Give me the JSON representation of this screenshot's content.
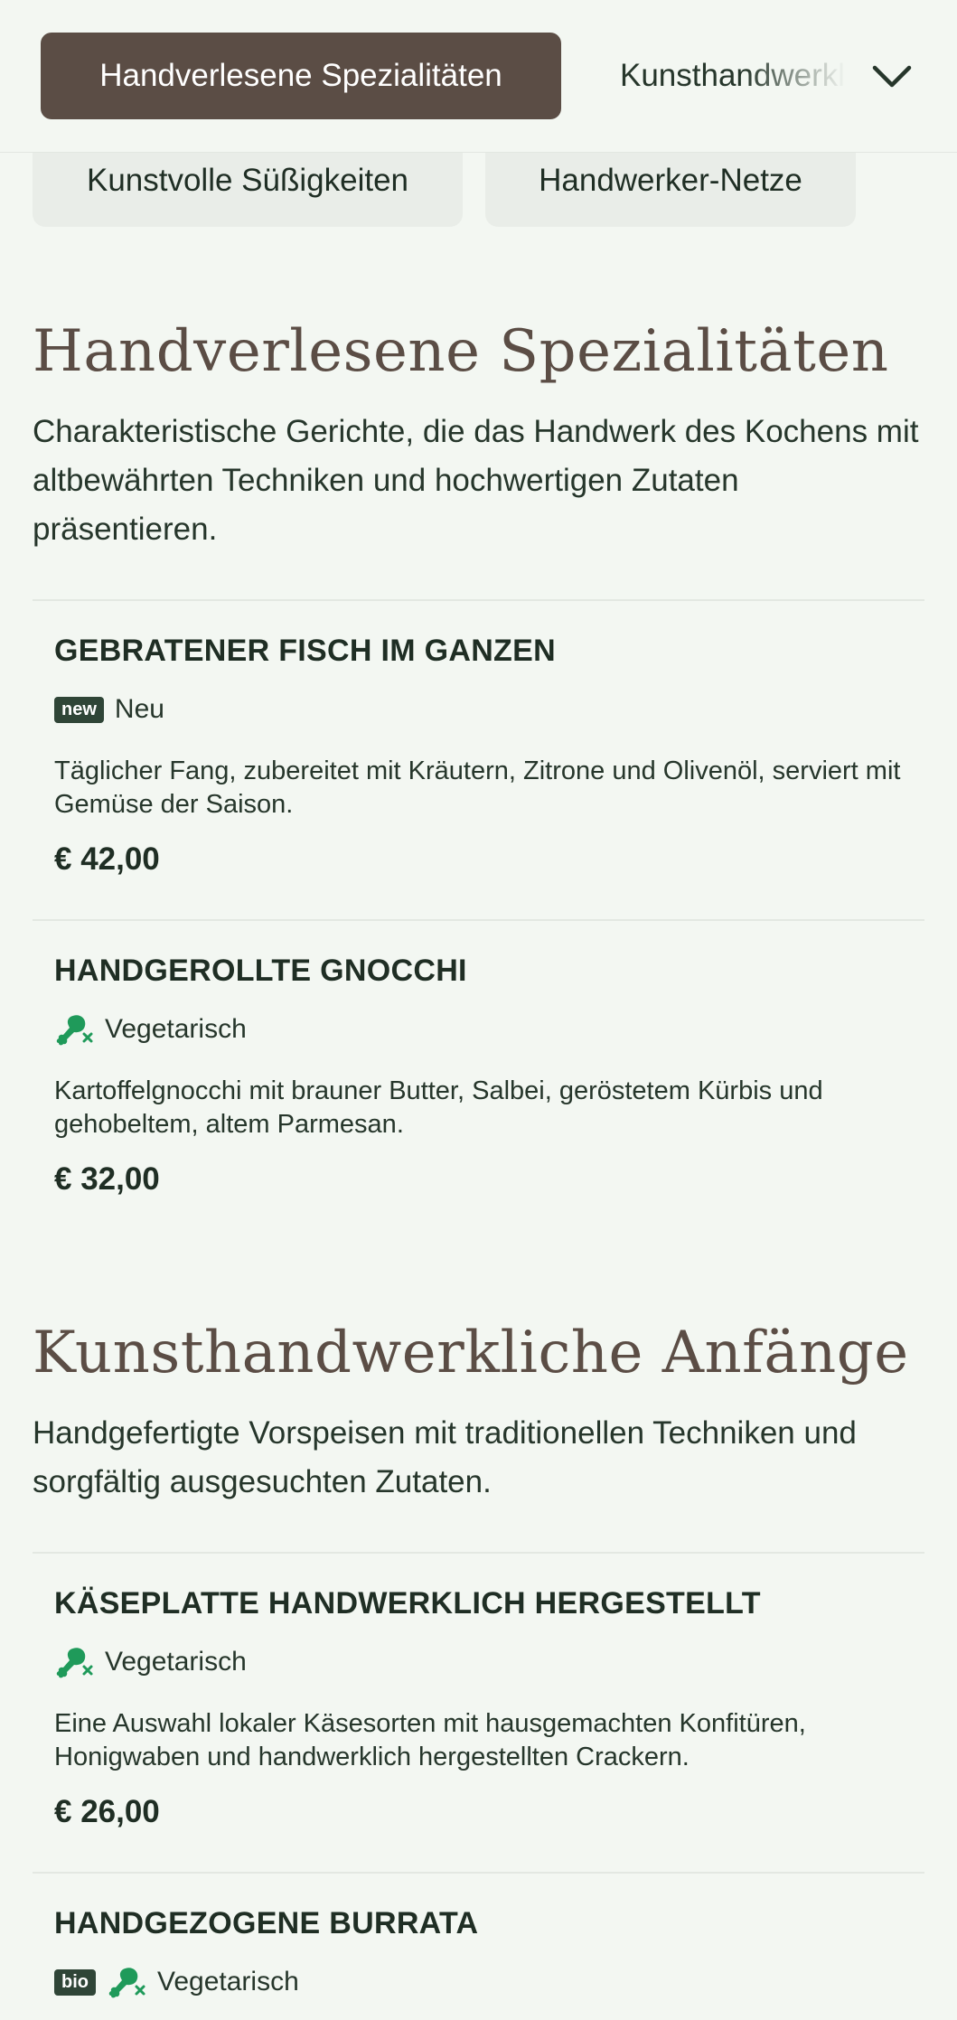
{
  "nav": {
    "active_tab": "Handverlesene Spezialitäten",
    "next_tab": "Kunsthandwerkliche Anfänge",
    "pills": [
      "Kunstvolle Süßigkeiten",
      "Handwerker-Netze"
    ]
  },
  "sections": [
    {
      "title": "Handverlesene Spezialitäten",
      "description": "Charakteristische Gerichte, die das Handwerk des Kochens mit altbewährten Techniken und hochwertigen Zutaten präsentieren.",
      "items": [
        {
          "name": "GEBRATENER FISCH IM GANZEN",
          "badge": "new",
          "tag": "Neu",
          "description": "Täglicher Fang, zubereitet mit Kräutern, Zitrone und Olivenöl, serviert mit Gemüse der Saison.",
          "price": "€ 42,00"
        },
        {
          "name": "HANDGEROLLTE GNOCCHI",
          "tag": "Vegetarisch",
          "description": "Kartoffelgnocchi mit brauner Butter, Salbei, geröstetem Kürbis und gehobeltem, altem Parmesan.",
          "price": "€ 32,00"
        }
      ]
    },
    {
      "title": "Kunsthandwerkliche Anfänge",
      "description": "Handgefertigte Vorspeisen mit traditionellen Techniken und sorgfältig ausgesuchten Zutaten.",
      "items": [
        {
          "name": "KÄSEPLATTE HANDWERKLICH HERGESTELLT",
          "tag": "Vegetarisch",
          "description": "Eine Auswahl lokaler Käsesorten mit hausgemachten Konfitüren, Honigwaben und handwerklich hergestellten Crackern.",
          "price": "€ 26,00"
        },
        {
          "name": "HANDGEZOGENE BURRATA",
          "badge": "bio",
          "tag": "Vegetarisch"
        }
      ]
    }
  ],
  "colors": {
    "background": "#f3f7f2",
    "accent_brown": "#5b4d45",
    "veg_green": "#1f9a5a",
    "badge_dark": "#2f4537"
  },
  "icons": {
    "vegetarian": "drumstick-crossed-icon",
    "menu_toggle": "chevron-down-icon"
  }
}
